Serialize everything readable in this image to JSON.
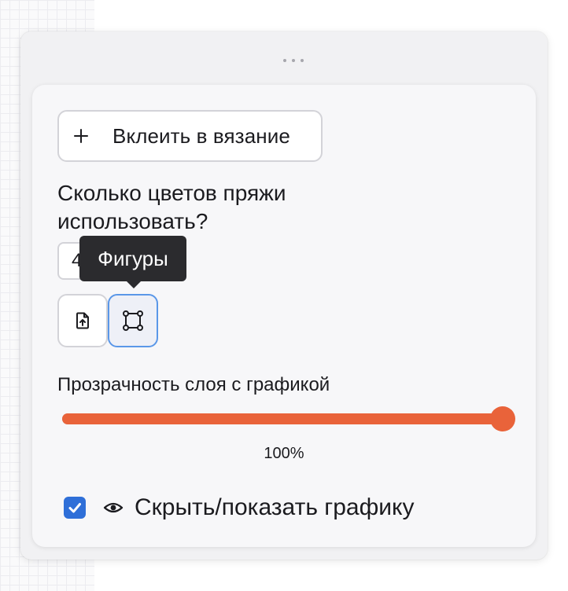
{
  "embed_button": {
    "label": "Вклеить в вязание",
    "icon": "plus-icon"
  },
  "colors_question": "Сколько цветов пряжи использовать?",
  "colors_input": {
    "value": "4"
  },
  "tools": {
    "tooltip": "Фигуры",
    "upload_icon": "file-upload-icon",
    "shapes_icon": "shape-frame-icon"
  },
  "opacity": {
    "label": "Прозрачность слоя с графикой",
    "value": 100,
    "display": "100%"
  },
  "graphics_toggle": {
    "checked": true,
    "icon": "eye-icon",
    "label": "Скрыть/показать графику"
  },
  "colors": {
    "accent": "#e9633a",
    "checkbox": "#2f6fd8",
    "focus_border": "#5a97e8",
    "tooltip_bg": "#2b2b2e"
  }
}
